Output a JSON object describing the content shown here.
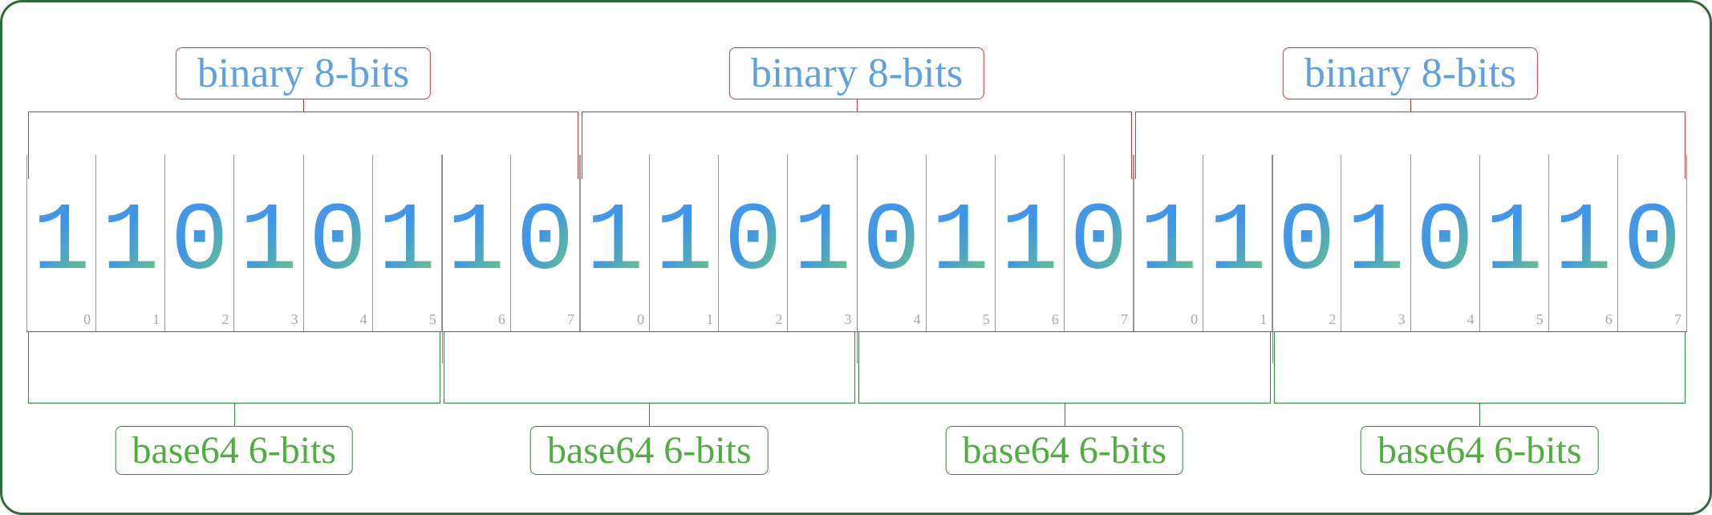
{
  "diagram": {
    "top_label": "binary 8-bits",
    "bottom_label": "base64 6-bits",
    "bytes": [
      {
        "bits": [
          "1",
          "1",
          "0",
          "1",
          "0",
          "1",
          "1",
          "0"
        ],
        "indices": [
          "0",
          "1",
          "2",
          "3",
          "4",
          "5",
          "6",
          "7"
        ]
      },
      {
        "bits": [
          "1",
          "1",
          "0",
          "1",
          "0",
          "1",
          "1",
          "0"
        ],
        "indices": [
          "0",
          "1",
          "2",
          "3",
          "4",
          "5",
          "6",
          "7"
        ]
      },
      {
        "bits": [
          "1",
          "1",
          "0",
          "1",
          "0",
          "1",
          "1",
          "0"
        ],
        "indices": [
          "0",
          "1",
          "2",
          "3",
          "4",
          "5",
          "6",
          "7"
        ]
      }
    ],
    "byte_groups": 3,
    "sixbit_groups": 4,
    "total_bits": 24,
    "colors": {
      "border": "#2d6b3a",
      "binary_bracket": "#d33",
      "binary_label_text": "#5fa1e0",
      "base64_bracket": "#2d8a3a",
      "base64_label_text": "#4fae3f",
      "bit_gradient_from": "#4f9de8",
      "bit_gradient_to": "#67c18a"
    }
  }
}
